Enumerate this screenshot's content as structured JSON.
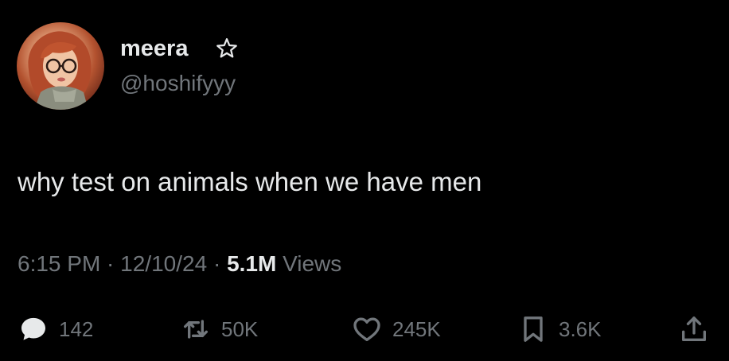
{
  "user": {
    "display_name": "meera",
    "badge_icon": "star-outline-icon",
    "handle": "@hoshifyyy",
    "avatar_icon": "avatar"
  },
  "tweet": {
    "text": "why test on animals when we have men"
  },
  "meta": {
    "time": "6:15 PM",
    "sep1": " · ",
    "date": "12/10/24",
    "sep2": " · ",
    "views_count": "5.1M",
    "views_label": " Views"
  },
  "actions": {
    "replies": {
      "icon": "reply-icon",
      "count": "142"
    },
    "retweets": {
      "icon": "retweet-icon",
      "count": "50K"
    },
    "likes": {
      "icon": "heart-icon",
      "count": "245K"
    },
    "bookmarks": {
      "icon": "bookmark-icon",
      "count": "3.6K"
    },
    "share": {
      "icon": "share-icon"
    }
  },
  "colors": {
    "background": "#000000",
    "primary_text": "#e7e9ea",
    "secondary_text": "#71767b"
  }
}
